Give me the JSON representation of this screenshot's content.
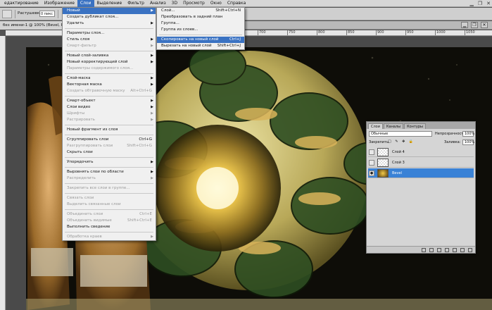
{
  "menubar": {
    "items": [
      "едактирование",
      "Изображение",
      "Слои",
      "Выделение",
      "Фильтр",
      "Анализ",
      "3D",
      "Просмотр",
      "Окно",
      "Справка"
    ],
    "active_index": 2
  },
  "options_bar": {
    "label": "Растушевка:",
    "value": "0 пикс"
  },
  "document": {
    "tab_title": "без имени-1 @ 100% (Bevel, RGB/8)"
  },
  "ruler": {
    "ticks": [
      "700",
      "750",
      "800",
      "850",
      "900",
      "950",
      "1000",
      "1050"
    ]
  },
  "layers_menu": {
    "items": [
      {
        "label": "Новый",
        "arrow": true,
        "highlight": true
      },
      {
        "label": "Создать дубликат слоя..."
      },
      {
        "label": "Удалить",
        "arrow": true
      },
      {
        "sep": true
      },
      {
        "label": "Параметры слоя..."
      },
      {
        "label": "Стиль слоя",
        "arrow": true
      },
      {
        "label": "Смарт-фильтр",
        "arrow": true,
        "disabled": true
      },
      {
        "sep": true
      },
      {
        "label": "Новый слой-заливка",
        "arrow": true
      },
      {
        "label": "Новый корректирующий слой",
        "arrow": true
      },
      {
        "label": "Параметры содержимого слоя...",
        "disabled": true
      },
      {
        "sep": true
      },
      {
        "label": "Слой-маска",
        "arrow": true
      },
      {
        "label": "Векторная маска",
        "arrow": true
      },
      {
        "label": "Создать обтравочную маску",
        "shortcut": "Alt+Ctrl+G",
        "disabled": true
      },
      {
        "sep": true
      },
      {
        "label": "Смарт-объект",
        "arrow": true
      },
      {
        "label": "Слои видео",
        "arrow": true
      },
      {
        "label": "Шрифты",
        "arrow": true,
        "disabled": true
      },
      {
        "label": "Растрировать",
        "arrow": true,
        "disabled": true
      },
      {
        "sep": true
      },
      {
        "label": "Новый фрагмент из слоя"
      },
      {
        "sep": true
      },
      {
        "label": "Сгруппировать слои",
        "shortcut": "Ctrl+G"
      },
      {
        "label": "Разгруппировать слои",
        "shortcut": "Shift+Ctrl+G",
        "disabled": true
      },
      {
        "label": "Скрыть слои"
      },
      {
        "sep": true
      },
      {
        "label": "Упорядочить",
        "arrow": true
      },
      {
        "sep": true
      },
      {
        "label": "Выровнять слои по области",
        "arrow": true
      },
      {
        "label": "Распределить",
        "arrow": true,
        "disabled": true
      },
      {
        "sep": true
      },
      {
        "label": "Закрепить все слои в группе...",
        "disabled": true
      },
      {
        "sep": true
      },
      {
        "label": "Связать слои",
        "disabled": true
      },
      {
        "label": "Выделить связанные слои",
        "disabled": true
      },
      {
        "sep": true
      },
      {
        "label": "Объединить слои",
        "shortcut": "Ctrl+E",
        "disabled": true
      },
      {
        "label": "Объединить видимые",
        "shortcut": "Shift+Ctrl+E",
        "disabled": true
      },
      {
        "label": "Выполнить сведение"
      },
      {
        "sep": true
      },
      {
        "label": "Обработка краев",
        "arrow": true,
        "disabled": true
      }
    ]
  },
  "new_submenu": {
    "items": [
      {
        "label": "Слой...",
        "shortcut": "Shift+Ctrl+N"
      },
      {
        "label": "Преобразовать в задний план"
      },
      {
        "label": "Группа..."
      },
      {
        "label": "Группа из слоев..."
      },
      {
        "sep": true
      },
      {
        "label": "Скопировать на новый слой",
        "shortcut": "Ctrl+J",
        "highlight": true
      },
      {
        "label": "Вырезать на новый слой",
        "shortcut": "Shift+Ctrl+J"
      }
    ]
  },
  "layers_panel": {
    "tabs": [
      "Слои",
      "Каналы",
      "Контуры"
    ],
    "blend_mode": "Обычные",
    "opacity_label": "Непрозрачность:",
    "opacity_value": "100%",
    "lock_label": "Закрепить:",
    "fill_label": "Заливка:",
    "fill_value": "100%",
    "layers": [
      {
        "name": "Слой 4",
        "selected": false,
        "visible": false
      },
      {
        "name": "Слой 3",
        "selected": false,
        "visible": false
      },
      {
        "name": "Bevel",
        "selected": true,
        "visible": true
      }
    ]
  },
  "colors": {
    "accent": "#3a72c2",
    "selected_layer": "#3a82d6",
    "menu_bg": "#f0f0f0",
    "app_bg": "#535353"
  }
}
